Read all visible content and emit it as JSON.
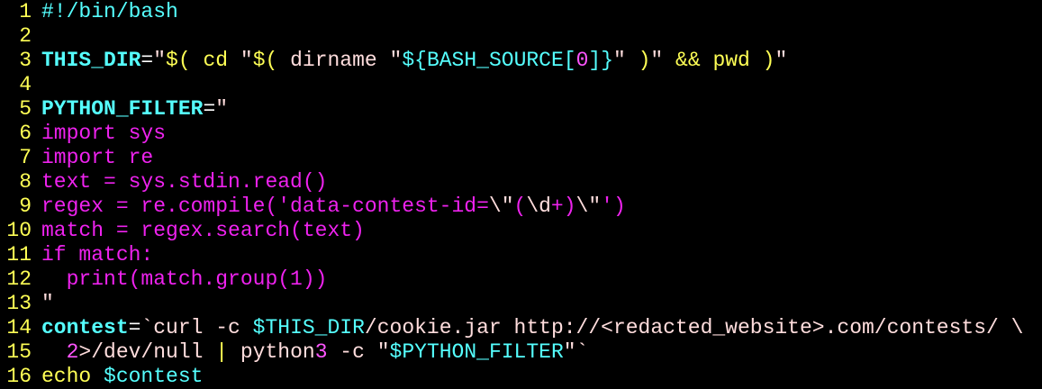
{
  "editor": {
    "lines": [
      {
        "num": "1",
        "segments": [
          {
            "t": "#!/bin/bash",
            "c": "c-comment"
          }
        ]
      },
      {
        "num": "2",
        "segments": []
      },
      {
        "num": "3",
        "segments": [
          {
            "t": "THIS_DIR",
            "c": "c-var"
          },
          {
            "t": "=",
            "c": "c-white"
          },
          {
            "t": "\"",
            "c": "c-pink"
          },
          {
            "t": "$(",
            "c": "c-yellow"
          },
          {
            "t": " cd ",
            "c": "c-yellow"
          },
          {
            "t": "\"",
            "c": "c-pink"
          },
          {
            "t": "$(",
            "c": "c-yellow"
          },
          {
            "t": " dirname ",
            "c": "c-pink"
          },
          {
            "t": "\"",
            "c": "c-pink"
          },
          {
            "t": "${BASH_SOURCE[",
            "c": "c-cyan"
          },
          {
            "t": "0",
            "c": "c-str"
          },
          {
            "t": "]}",
            "c": "c-cyan"
          },
          {
            "t": "\"",
            "c": "c-pink"
          },
          {
            "t": " )",
            "c": "c-yellow"
          },
          {
            "t": "\"",
            "c": "c-pink"
          },
          {
            "t": " && pwd )",
            "c": "c-yellow"
          },
          {
            "t": "\"",
            "c": "c-pink"
          }
        ]
      },
      {
        "num": "4",
        "segments": []
      },
      {
        "num": "5",
        "segments": [
          {
            "t": "PYTHON_FILTER",
            "c": "c-var"
          },
          {
            "t": "=",
            "c": "c-white"
          },
          {
            "t": "\"",
            "c": "c-pink"
          }
        ]
      },
      {
        "num": "6",
        "segments": [
          {
            "t": "import sys",
            "c": "c-magenta"
          }
        ]
      },
      {
        "num": "7",
        "segments": [
          {
            "t": "import re",
            "c": "c-magenta"
          }
        ]
      },
      {
        "num": "8",
        "segments": [
          {
            "t": "text = sys.stdin.read()",
            "c": "c-magenta"
          }
        ]
      },
      {
        "num": "9",
        "segments": [
          {
            "t": "regex = re.compile('data-contest-id=",
            "c": "c-magenta"
          },
          {
            "t": "\\\"",
            "c": "c-pink"
          },
          {
            "t": "(",
            "c": "c-magenta"
          },
          {
            "t": "\\d",
            "c": "c-pink"
          },
          {
            "t": "+)",
            "c": "c-magenta"
          },
          {
            "t": "\\\"",
            "c": "c-pink"
          },
          {
            "t": "')",
            "c": "c-magenta"
          }
        ]
      },
      {
        "num": "10",
        "segments": [
          {
            "t": "match = regex.search(text)",
            "c": "c-magenta"
          }
        ]
      },
      {
        "num": "11",
        "segments": [
          {
            "t": "if match:",
            "c": "c-magenta"
          }
        ]
      },
      {
        "num": "12",
        "segments": [
          {
            "t": "  print(match.group(1))",
            "c": "c-magenta"
          }
        ]
      },
      {
        "num": "13",
        "segments": [
          {
            "t": "\"",
            "c": "c-pink"
          }
        ]
      },
      {
        "num": "14",
        "segments": [
          {
            "t": "contest",
            "c": "c-var"
          },
          {
            "t": "=",
            "c": "c-white"
          },
          {
            "t": "`curl -c ",
            "c": "c-pink"
          },
          {
            "t": "$THIS_DIR",
            "c": "c-cyan"
          },
          {
            "t": "/cookie.jar http://<redacted_website>.com/contests/ \\",
            "c": "c-pink"
          }
        ]
      },
      {
        "num": "15",
        "segments": [
          {
            "t": "  ",
            "c": "c-pink"
          },
          {
            "t": "2",
            "c": "c-str"
          },
          {
            "t": ">/dev/null ",
            "c": "c-pink"
          },
          {
            "t": "|",
            "c": "c-yellow"
          },
          {
            "t": " python",
            "c": "c-pink"
          },
          {
            "t": "3",
            "c": "c-str"
          },
          {
            "t": " -c ",
            "c": "c-pink"
          },
          {
            "t": "\"",
            "c": "c-pink"
          },
          {
            "t": "$PYTHON_FILTER",
            "c": "c-cyan"
          },
          {
            "t": "\"",
            "c": "c-pink"
          },
          {
            "t": "`",
            "c": "c-pink"
          }
        ]
      },
      {
        "num": "16",
        "segments": [
          {
            "t": "echo ",
            "c": "c-yellow"
          },
          {
            "t": "$contest",
            "c": "c-cyan"
          }
        ]
      }
    ]
  }
}
